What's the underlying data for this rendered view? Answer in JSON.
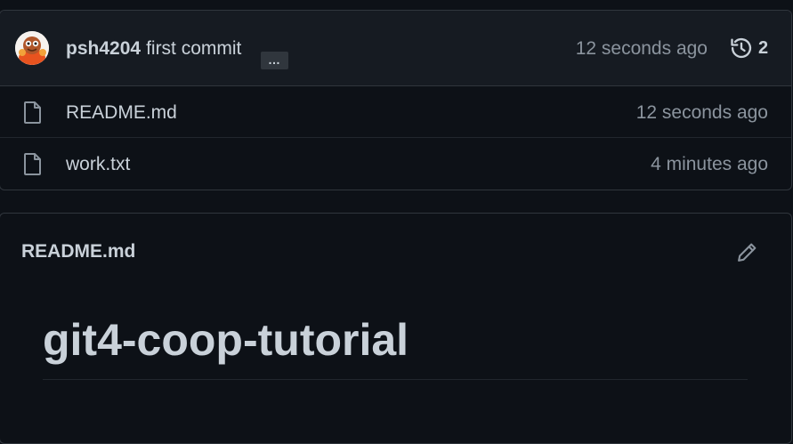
{
  "commit": {
    "author": "psh4204",
    "message": "first commit",
    "ellipsis": "…",
    "time": "12 seconds ago",
    "history_count": "2"
  },
  "files": [
    {
      "name": "README.md",
      "time": "12 seconds ago",
      "icon": "file-icon"
    },
    {
      "name": "work.txt",
      "time": "4 minutes ago",
      "icon": "file-icon"
    }
  ],
  "readme": {
    "header_title": "README.md",
    "heading": "git4-coop-tutorial"
  },
  "colors": {
    "background": "#0d1117",
    "header_bg": "#161b22",
    "border": "#30363d",
    "text": "#c9d1d9",
    "muted": "#8b949e"
  }
}
